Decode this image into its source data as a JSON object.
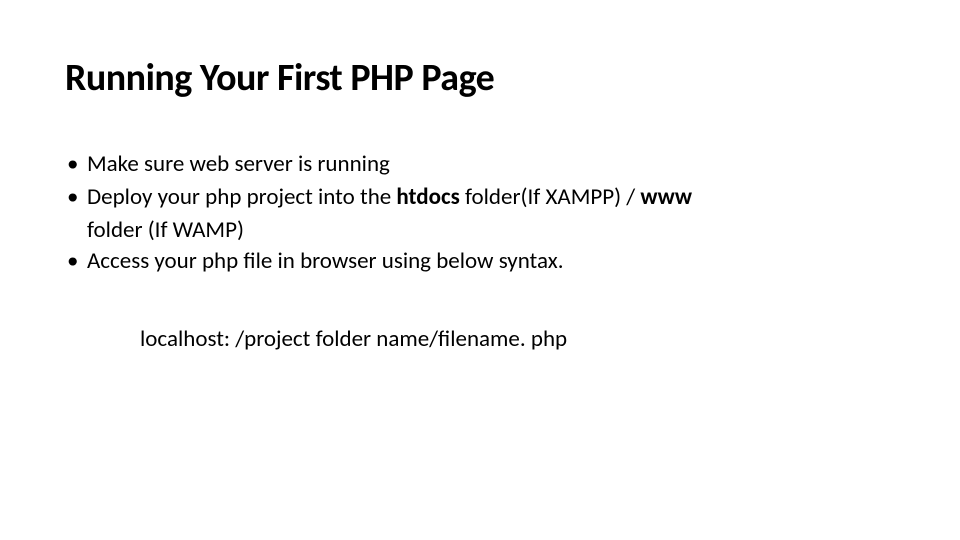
{
  "title": "Running Your First PHP Page",
  "bullets": {
    "b1": "Make sure web server is running",
    "b2_part1": "Deploy your php project into the ",
    "b2_bold1": "htdocs",
    "b2_part2": " folder(If XAMPP) / ",
    "b2_bold2": "www",
    "b2_cont": "folder (If WAMP)",
    "b3": "Access your php file in browser using below syntax."
  },
  "syntax": "localhost: /project folder name/filename. php"
}
